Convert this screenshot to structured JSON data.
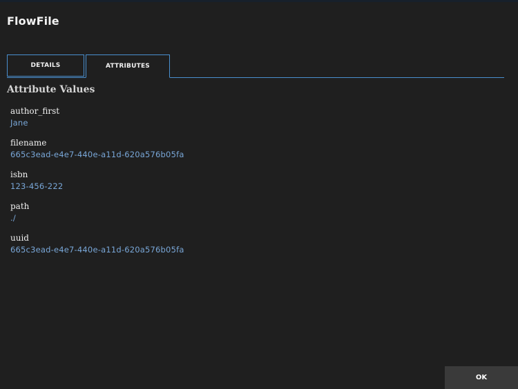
{
  "dialog": {
    "title": "FlowFile"
  },
  "tabs": [
    {
      "label": "DETAILS",
      "active": false
    },
    {
      "label": "ATTRIBUTES",
      "active": true
    }
  ],
  "section": {
    "title": "Attribute Values"
  },
  "attributes": [
    {
      "name": "author_first",
      "value": "Jane"
    },
    {
      "name": "filename",
      "value": "665c3ead-e4e7-440e-a11d-620a576b05fa"
    },
    {
      "name": "isbn",
      "value": "123-456-222"
    },
    {
      "name": "path",
      "value": "./"
    },
    {
      "name": "uuid",
      "value": "665c3ead-e4e7-440e-a11d-620a576b05fa"
    }
  ],
  "footer": {
    "ok_label": "OK"
  },
  "colors": {
    "background": "#1f1f1f",
    "accent": "#4a90d0",
    "value_text": "#79a7d8",
    "button_bg": "#3a3a3a"
  }
}
